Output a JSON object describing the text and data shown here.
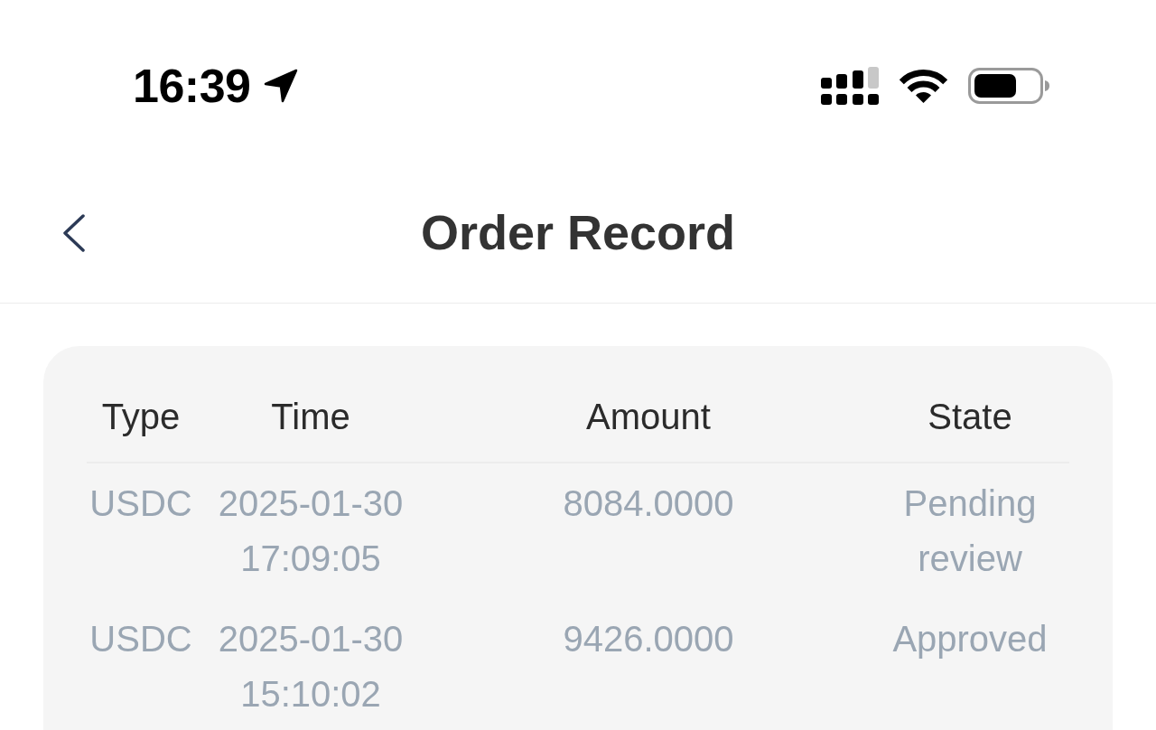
{
  "status_bar": {
    "time": "16:39"
  },
  "header": {
    "title": "Order Record"
  },
  "table": {
    "columns": [
      "Type",
      "Time",
      "Amount",
      "State"
    ],
    "rows": [
      {
        "cells": [
          "USDC",
          "2025-01-30 17:09:05",
          "8084.0000",
          "Pending review"
        ]
      },
      {
        "cells": [
          "USDC",
          "2025-01-30 15:10:02",
          "9426.0000",
          "Approved"
        ]
      }
    ]
  }
}
